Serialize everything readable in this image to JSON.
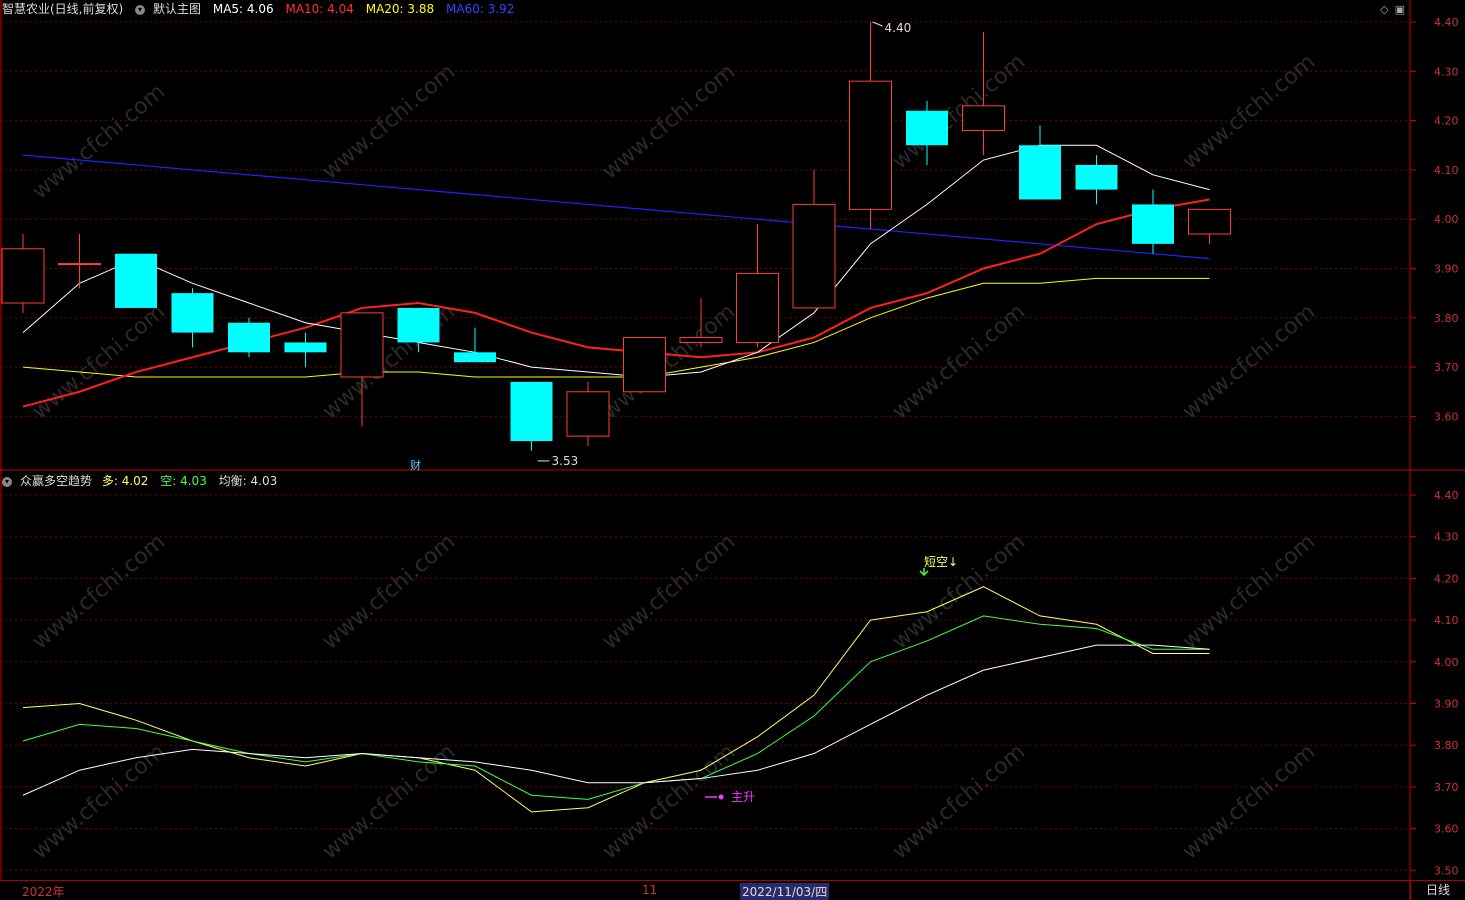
{
  "header_main": {
    "title": "智慧农业(日线,前复权)",
    "template": "默认主图",
    "ma5": "MA5: 4.06",
    "ma10": "MA10: 4.04",
    "ma20": "MA20: 3.88",
    "ma60": "MA60: 3.92"
  },
  "header_sub": {
    "title": "众赢多空趋势",
    "duo": "多: 4.02",
    "kong": "空: 4.03",
    "junheng": "均衡: 4.03"
  },
  "top_icons": [
    "diamond-icon",
    "window-icon"
  ],
  "date_axis": {
    "year_label": "2022年",
    "month_label": "11",
    "selected_date": "2022/11/03/四"
  },
  "period_label": "日线",
  "watermark": "www.cfchi.com",
  "colors": {
    "up": "#ff3c3c",
    "down": "#00ffff",
    "ma5": "#ffffff",
    "ma10": "#ff2020",
    "ma20": "#ffff00",
    "ma60": "#2020ff",
    "duo": "#ffff66",
    "kong": "#44ff44",
    "junheng": "#ffffff",
    "axis": "#cc0000",
    "grid": "#7a0000"
  },
  "chart_data": [
    {
      "type": "candlestick",
      "title": "智慧农业(日线,前复权)",
      "ylim": [
        3.5,
        4.45
      ],
      "yticks": [
        "4.40",
        "4.30",
        "4.20",
        "4.10",
        "4.00",
        "3.90",
        "3.80",
        "3.70",
        "3.60"
      ],
      "candles": [
        {
          "open": 3.83,
          "close": 3.94,
          "high": 3.97,
          "low": 3.81
        },
        {
          "open": 3.91,
          "close": 3.91,
          "high": 3.97,
          "low": 3.86
        },
        {
          "open": 3.93,
          "close": 3.82,
          "high": 3.93,
          "low": 3.82
        },
        {
          "open": 3.85,
          "close": 3.77,
          "high": 3.86,
          "low": 3.74
        },
        {
          "open": 3.79,
          "close": 3.73,
          "high": 3.8,
          "low": 3.72
        },
        {
          "open": 3.75,
          "close": 3.73,
          "high": 3.77,
          "low": 3.7
        },
        {
          "open": 3.68,
          "close": 3.81,
          "high": 3.81,
          "low": 3.58
        },
        {
          "open": 3.82,
          "close": 3.75,
          "high": 3.82,
          "low": 3.73
        },
        {
          "open": 3.73,
          "close": 3.71,
          "high": 3.78,
          "low": 3.71
        },
        {
          "open": 3.67,
          "close": 3.55,
          "high": 3.67,
          "low": 3.53
        },
        {
          "open": 3.56,
          "close": 3.65,
          "high": 3.67,
          "low": 3.54
        },
        {
          "open": 3.65,
          "close": 3.76,
          "high": 3.76,
          "low": 3.65
        },
        {
          "open": 3.75,
          "close": 3.76,
          "high": 3.84,
          "low": 3.74
        },
        {
          "open": 3.75,
          "close": 3.89,
          "high": 3.99,
          "low": 3.74
        },
        {
          "open": 3.82,
          "close": 4.03,
          "high": 4.1,
          "low": 3.82
        },
        {
          "open": 4.02,
          "close": 4.28,
          "high": 4.4,
          "low": 3.98
        },
        {
          "open": 4.22,
          "close": 4.15,
          "high": 4.24,
          "low": 4.11
        },
        {
          "open": 4.18,
          "close": 4.23,
          "high": 4.38,
          "low": 4.13
        },
        {
          "open": 4.15,
          "close": 4.04,
          "high": 4.19,
          "low": 4.04
        },
        {
          "open": 4.11,
          "close": 4.06,
          "high": 4.13,
          "low": 4.03
        },
        {
          "open": 4.03,
          "close": 3.95,
          "high": 4.06,
          "low": 3.93
        },
        {
          "open": 3.97,
          "close": 4.02,
          "high": 4.02,
          "low": 3.95
        }
      ],
      "ma5": [
        3.77,
        3.87,
        3.92,
        3.87,
        3.83,
        3.79,
        3.77,
        3.75,
        3.73,
        3.7,
        3.69,
        3.68,
        3.69,
        3.73,
        3.81,
        3.95,
        4.03,
        4.12,
        4.15,
        4.15,
        4.09,
        4.06
      ],
      "ma10": [
        3.62,
        3.65,
        3.69,
        3.72,
        3.75,
        3.78,
        3.82,
        3.83,
        3.81,
        3.77,
        3.74,
        3.73,
        3.72,
        3.73,
        3.76,
        3.82,
        3.85,
        3.9,
        3.93,
        3.99,
        4.02,
        4.04
      ],
      "ma20": [
        3.7,
        3.69,
        3.68,
        3.68,
        3.68,
        3.68,
        3.69,
        3.69,
        3.68,
        3.68,
        3.68,
        3.68,
        3.7,
        3.72,
        3.75,
        3.8,
        3.84,
        3.87,
        3.87,
        3.88,
        3.88,
        3.88
      ],
      "ma60_start": 4.13,
      "ma60_end": 3.92,
      "annotations": [
        "4.40",
        "3.53",
        "财"
      ]
    },
    {
      "type": "line",
      "title": "众赢多空趋势",
      "ylim": [
        3.5,
        4.45
      ],
      "yticks": [
        "4.40",
        "4.30",
        "4.20",
        "4.10",
        "4.00",
        "3.90",
        "3.80",
        "3.70",
        "3.60",
        "3.50"
      ],
      "series": [
        {
          "name": "多",
          "values": [
            3.89,
            3.9,
            3.86,
            3.81,
            3.77,
            3.75,
            3.78,
            3.77,
            3.74,
            3.64,
            3.65,
            3.71,
            3.74,
            3.82,
            3.92,
            4.1,
            4.12,
            4.18,
            4.11,
            4.09,
            4.02,
            4.02
          ]
        },
        {
          "name": "空",
          "values": [
            3.81,
            3.85,
            3.84,
            3.81,
            3.78,
            3.76,
            3.78,
            3.76,
            3.75,
            3.68,
            3.67,
            3.71,
            3.72,
            3.78,
            3.87,
            4.0,
            4.05,
            4.11,
            4.09,
            4.08,
            4.03,
            4.03
          ]
        },
        {
          "name": "均衡",
          "values": [
            3.68,
            3.74,
            3.77,
            3.79,
            3.78,
            3.77,
            3.78,
            3.77,
            3.76,
            3.74,
            3.71,
            3.71,
            3.72,
            3.74,
            3.78,
            3.85,
            3.92,
            3.98,
            4.01,
            4.04,
            4.04,
            4.03
          ]
        }
      ],
      "signals": [
        "短空↓",
        "主升"
      ]
    }
  ]
}
